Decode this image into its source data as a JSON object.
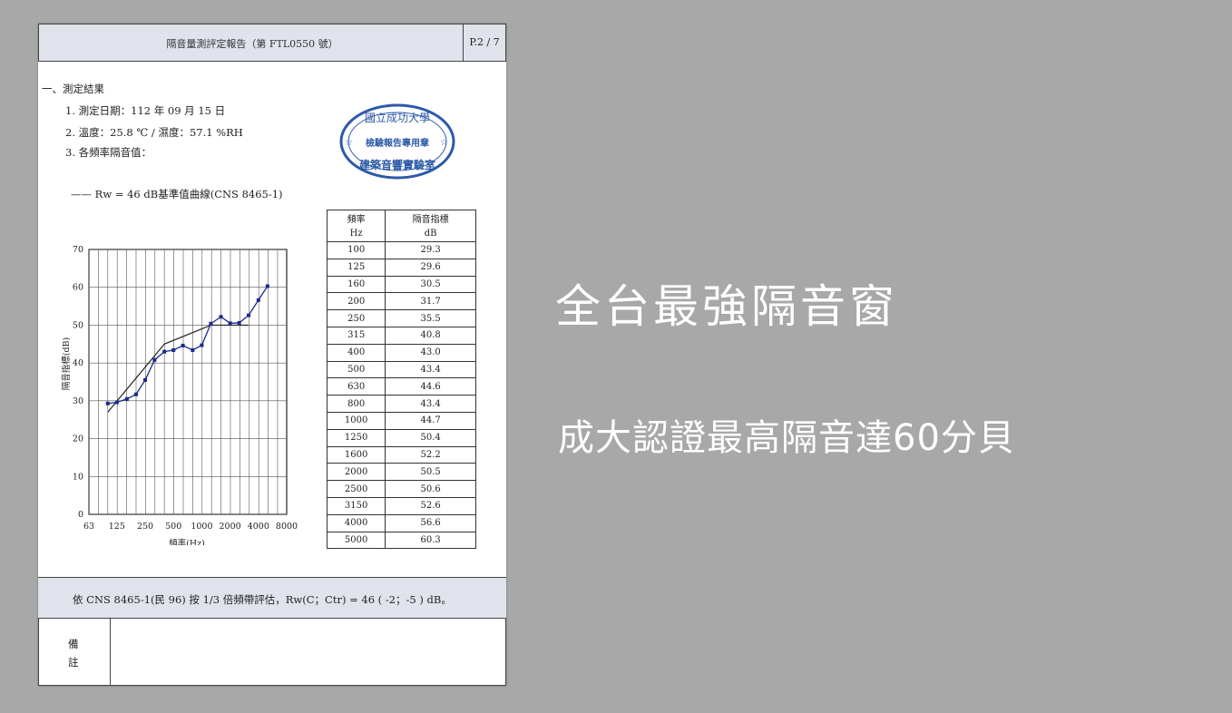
{
  "document": {
    "header_title": "隔音量測評定報告（第 FTL0550 號）",
    "page_number": "P.2 / 7",
    "section_title": "一、測定結果",
    "items": [
      "1.  測定日期：112 年 09 月 15 日",
      "2.  溫度：25.8 ℃  /  濕度：57.1 %RH",
      "3.  各頻率隔音值："
    ],
    "seal": {
      "top": "國立成功大學",
      "middle": "檢驗報告專用章",
      "bottom": "建築音響實驗室",
      "color": "#2c5aa8"
    },
    "legend_text": "——  Rw  = 46 dB基準值曲線(CNS 8465-1)",
    "footer_text": "依 CNS 8465-1(民 96) 按 1/3 倍頻帶評估，Rw(C；Ctr) = 46 ( -2；-5 ) dB。",
    "remark_label": "備註"
  },
  "table": {
    "col1_header": "頻率",
    "col1_unit": "Hz",
    "col2_header": "隔音指標",
    "col2_unit": "dB",
    "rows": [
      [
        "100",
        "29.3"
      ],
      [
        "125",
        "29.6"
      ],
      [
        "160",
        "30.5"
      ],
      [
        "200",
        "31.7"
      ],
      [
        "250",
        "35.5"
      ],
      [
        "315",
        "40.8"
      ],
      [
        "400",
        "43.0"
      ],
      [
        "500",
        "43.4"
      ],
      [
        "630",
        "44.6"
      ],
      [
        "800",
        "43.4"
      ],
      [
        "1000",
        "44.7"
      ],
      [
        "1250",
        "50.4"
      ],
      [
        "1600",
        "52.2"
      ],
      [
        "2000",
        "50.5"
      ],
      [
        "2500",
        "50.6"
      ],
      [
        "3150",
        "52.6"
      ],
      [
        "4000",
        "56.6"
      ],
      [
        "5000",
        "60.3"
      ]
    ]
  },
  "chart_data": {
    "type": "line",
    "xlabel": "頻率(Hz)",
    "ylabel": "隔音指標(dB)",
    "ylim": [
      0,
      70
    ],
    "y_ticks": [
      "0",
      "10",
      "20",
      "30",
      "40",
      "50",
      "60",
      "70"
    ],
    "x_ticks": [
      "63",
      "125",
      "250",
      "500",
      "1000",
      "2000",
      "4000",
      "8000"
    ],
    "x": [
      100,
      125,
      160,
      200,
      250,
      315,
      400,
      500,
      630,
      800,
      1000,
      1250,
      1600,
      2000,
      2500,
      3150,
      4000,
      5000
    ],
    "series": [
      {
        "values": [
          29.3,
          29.6,
          30.5,
          31.7,
          35.5,
          40.8,
          43.0,
          43.4,
          44.6,
          43.4,
          44.7,
          50.4,
          52.2,
          50.5,
          50.6,
          52.6,
          56.6,
          60.3
        ],
        "color": "#1b2a8a"
      },
      {
        "x": [
          100,
          400,
          1250,
          3150
        ],
        "values": [
          27,
          45,
          50,
          50
        ],
        "color": "#222222"
      }
    ],
    "grid": true
  },
  "headline": {
    "line1": "全台最強隔音窗",
    "line2": "成大認證最高隔音達60分貝"
  }
}
